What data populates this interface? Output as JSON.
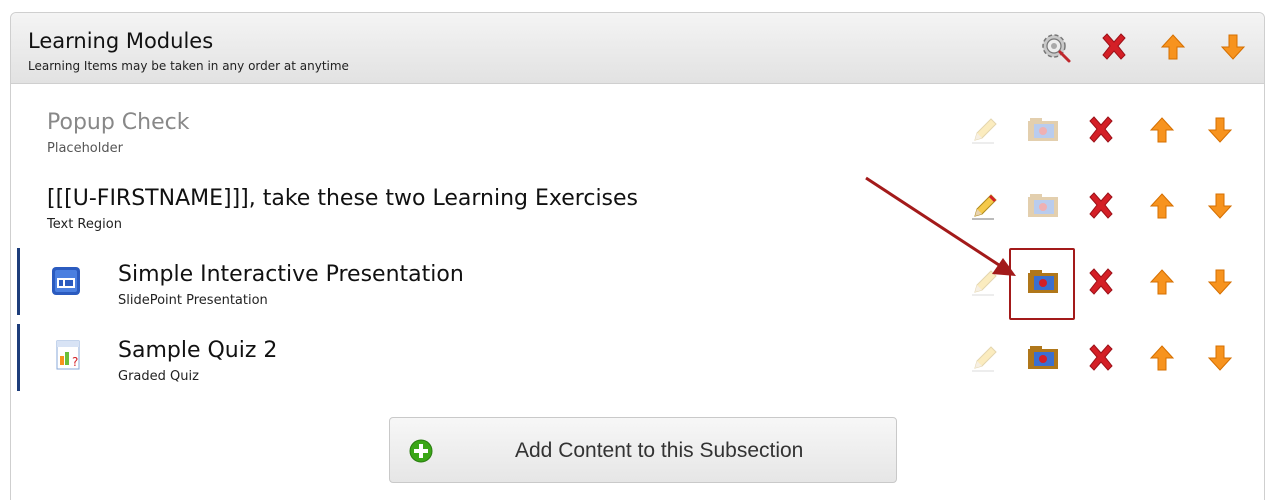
{
  "header": {
    "title": "Learning Modules",
    "subtitle": "Learning Items may be taken in any order at anytime"
  },
  "items": [
    {
      "title": "Popup Check",
      "type": "Placeholder"
    },
    {
      "title": "[[[U-FIRSTNAME]]], take these two Learning Exercises",
      "type": "Text Region"
    },
    {
      "title": "Simple Interactive Presentation",
      "type": "SlidePoint Presentation"
    },
    {
      "title": "Sample Quiz 2",
      "type": "Graded Quiz"
    }
  ],
  "add_button": {
    "label": "Add Content to this Subsection"
  },
  "icons": {
    "settings": "gear-icon",
    "delete": "red-x-icon",
    "move_up": "arrow-up-icon",
    "move_down": "arrow-down-icon",
    "edit": "pencil-icon",
    "media": "media-folder-icon",
    "presentation": "presentation-icon",
    "quiz": "quiz-icon",
    "add": "plus-icon"
  },
  "colors": {
    "accent_orange": "#f7931e",
    "delete_red": "#d41f26",
    "highlight": "#a31a1a",
    "item_bar": "#1d3d7a"
  }
}
